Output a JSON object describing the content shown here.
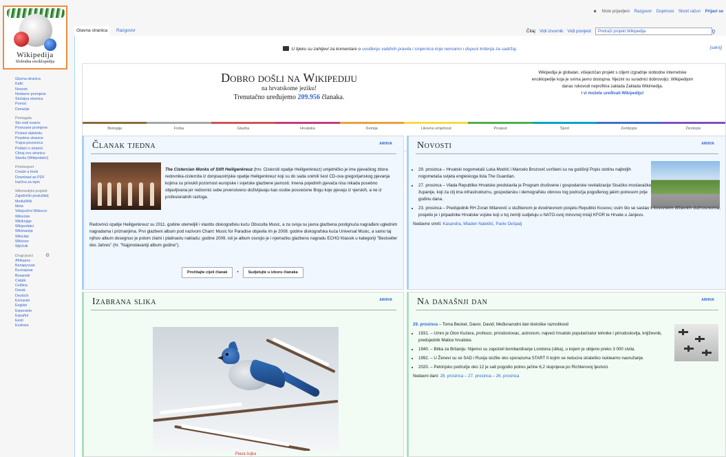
{
  "personal": {
    "user": "Niste prijavljeni",
    "links": [
      "Razgovor",
      "Doprinosi",
      "Stvori račun"
    ],
    "login": "Prijavi se"
  },
  "logo": {
    "wordmark": "Wikipedija",
    "tagline": "Slobodna enciklopedija"
  },
  "tabs": {
    "main_page": "Glavna stranica",
    "talk": "Razgovor"
  },
  "views": {
    "read": "Čitaj",
    "view_source": "Vidi izvornik",
    "history": "Vidi povijest"
  },
  "search": {
    "placeholder": "Pretraži projekt Wikipedija"
  },
  "sidebar": {
    "nav": [
      "Glavna stranica",
      "Kafić",
      "Novosti",
      "Nedavne promjene",
      "Slučajna stranica",
      "Pomoć",
      "Donacije"
    ],
    "tools_heading": "Pomagala",
    "tools": [
      "Što vodi ovamo",
      "Povezane promjene",
      "Postavi datoteku",
      "Posebne stranice",
      "Trajna poveznica",
      "Podatci o stranici",
      "Citiraj ovu stranicu",
      "Stavka (Wikipodatci)"
    ],
    "print_heading": "Print/export",
    "print": [
      "Create a book",
      "Download as PDF",
      "Inačica za ispis"
    ],
    "projects_heading": "Wikimedijini projekti",
    "projects": [
      "Zajednički poslužitelj",
      "MediaWiki",
      "Meta",
      "Višejezični Wikizvor",
      "Wikivrste",
      "Wikiknjige",
      "Wikipodatci",
      "Wikimanija",
      "Wikicitat",
      "Wikizvor",
      "Wječnik"
    ],
    "languages_heading": "Drugi jezici",
    "languages": [
      "Afrikaans",
      "Беларуская",
      "Български",
      "Bosanski",
      "Català",
      "Čeština",
      "Dansk",
      "Deutsch",
      "Ελληνικά",
      "English",
      "Esperanto",
      "Español",
      "Eesti",
      "Euskara"
    ]
  },
  "notice": {
    "text_pre": "U tijeku su zahtjevi za komentare o ",
    "link": "uvođenju validnih pravila i smjernica koje nemamo i dopuni kriterija za sadržaj.",
    "close": "[sakrij]"
  },
  "welcome": {
    "title": "Dobro došli na Wikipediju",
    "subtitle": "na hrvatskome jeziku!",
    "count_pre": "Trenutačno uređujemo ",
    "count": "209.956",
    "count_post": " članaka.",
    "right_line1": "Wikipedija je globalan, višejezičan projekt s ciljem izgradnje slobodne internetske",
    "right_line2": "enciklopedije koja je svima javno dostupna. Njezini su suradnici dobrovoljci. Wikipedijom",
    "right_line3": "danas rukovodi neprofitna zaklada Zaklada Wikimedija.",
    "right_line4": "I vi možete uređivati Wikipediju!"
  },
  "portals": [
    "Biologija",
    "Fizika",
    "Glazba",
    "Hrvatska",
    "Kemija",
    "Likovna umjetnost",
    "Povijest",
    "Šport",
    "Zemljopis",
    "Životopis"
  ],
  "article": {
    "title": "Članak tjedna",
    "archive": "ARHIVA",
    "lead_bold": "The Cistercian Monks of Stift Heiligenkreuz",
    "lead_rest": " (hrv. Cisterciti opatije Heiligenkreuz) umjetničko je ime pjevačkog zbora redovnika-cistercita iz donjoaustrijske opatije Heiligenkreuz koji su do sada snimili šest CD-ova gregorijanskog pjevanja kojima su privukli pozornost europske i svjetske glazbene javnosti. Imena pojedinih pjevača nisu nikada posebno objavljivana jer redovnici sebe prvenstveno doživljavaju kao osobe posvećene Bogu koje pjevaju iz vjerskih, a ne iz profesionalnih razloga.",
    "body": "Redovnici opatije Heiligenkreuz su 2011. godine utemeljili i vlastitu diskografsku kuću Obsculta Music, a za svoja su javna glazbena postignuća nagrađeni uglednim nagradama i priznanjima. Prvi glazbeni album pod nazivom Chant: Music for Paradise objavila im je 2008. godine diskografska kuća Universal Music, a samo taj njihov album dosegnuo je potom zlatni i platinastu nakladu; godine 2009. isti je album osvojio je i njemačku glazbenu nagradu ECHO Klassik u kategoriji \"Bestseller des Jahres\" (hr. \"Najprodavaniji album godine\").",
    "btn_read": "Pročitajte cijeli članak",
    "btn_join": "Sudjelujte u izboru članaka"
  },
  "news": {
    "title": "Novosti",
    "archive": "ARHIVA",
    "items": [
      "29. prosinca – Hrvatski nogometaši Luka Modrić i Marcelo Brozović uvršteni su na godišnji Popis stotinu najboljih nogometaša svijeta engleskoga lista The Guardian.",
      "27. prosinca – Vlada Republike Hrvatske predstavila je Program društvene i gospodarske revitalizacije Sisačko-moslavačke županije, koji za cilj ima infrastrukturnu, gospodarsku i demografsku obnovu tog područja pogođenog jakim potresom prije godinu dana.",
      "23. prosinca – Predsjednik RH Zoran Milanović u službenom je dvodnevnom posjetu Republici Kosovu; osim što se sastao s kosovskim državnim dužnosnicima, posjetio je i pripadnike Hrvatske vojske koji u toj zemlji sudjeluju u NATO-ovoj mirovnoj misiji KFOR te Hrvate u Janjevu."
    ],
    "deaths_label": "Nedavne smrti: ",
    "deaths": "Kasandra, Mladen Naletilić, Pavle Dešpalj"
  },
  "picture": {
    "title": "Izabrana slika",
    "archive": "ARHIVA",
    "caption": "Plava šojka"
  },
  "today": {
    "title": "Na današnji dan",
    "archive": "ARHIVA",
    "date_line_bold": "29. prosinca",
    "date_line_rest": " – Toma Becket, Davor, David; Međunarodni dan biološke raznolikosti",
    "items": [
      "1931. – Umro je Oton Kučera, profesor, prirodoslovac, astronom, najveći hrvatski popularizator tehnike i prirodoslovlja, književnik, predsjednik Matice hrvatske.",
      "1940. – Bitka za Britaniju: Nijemci su započeli bombardiranje Londona (slika), u kojem je ubijeno preko 3 000 civila.",
      "1992. – U Ženevi su se SAD i Rusija složile oko sporazuma START II kojim se reducira strateško nuklearno naoružanje.",
      "2020. – Petrinjsko područje oko 12 je sati pogodio potres jačine 6,2 stupnjeva po Richterovoj ljestvici."
    ],
    "recent_label": "Nedavni dani: ",
    "recent": "28. prosinca – 27. prosinca – 26. prosinca"
  },
  "colors": {
    "link": "#3366cc",
    "annotation_arrow": "#f08a3c"
  }
}
